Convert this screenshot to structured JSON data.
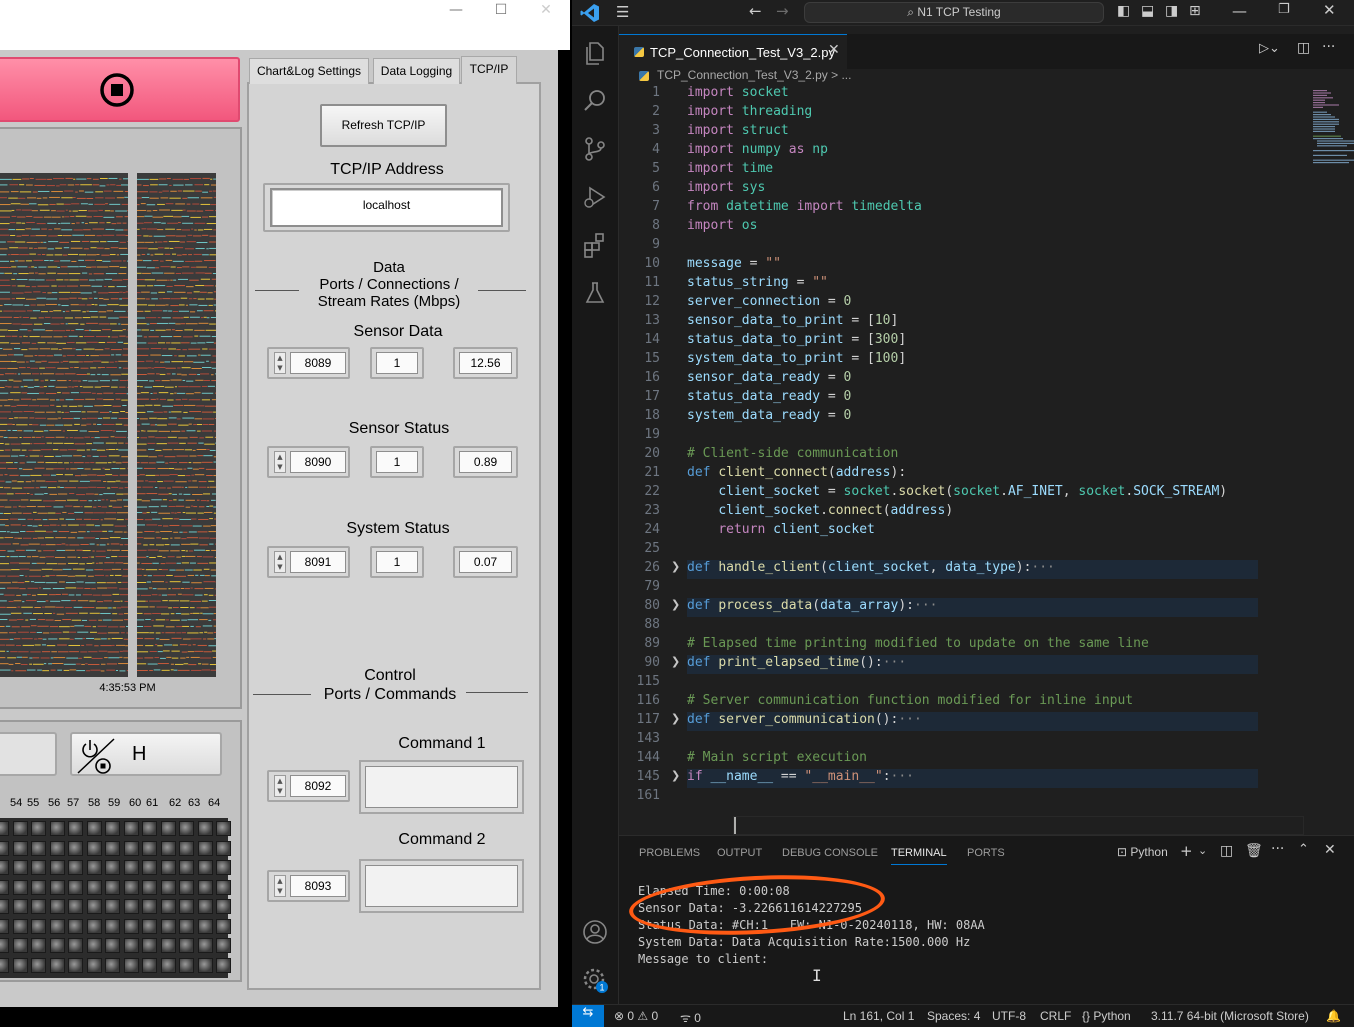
{
  "labview": {
    "window_controls": [
      "—",
      "☐",
      "✕"
    ],
    "tabs": [
      "Chart&Log Settings",
      "Data Logging",
      "TCP/IP"
    ],
    "refresh_label": "Refresh TCP/IP",
    "tcp_address_label": "TCP/IP Address",
    "tcp_address_value": "localhost",
    "data_section": [
      "Data",
      "Ports / Connections /",
      "Stream Rates (Mbps)"
    ],
    "sensor_data": {
      "label": "Sensor Data",
      "port": "8089",
      "connections": "1",
      "rate": "12.56"
    },
    "sensor_status": {
      "label": "Sensor Status",
      "port": "8090",
      "connections": "1",
      "rate": "0.89"
    },
    "system_status": {
      "label": "System Status",
      "port": "8091",
      "connections": "1",
      "rate": "0.07"
    },
    "control_section": [
      "Control",
      "Ports / Commands"
    ],
    "command1": {
      "label": "Command 1",
      "port": "8092"
    },
    "command2": {
      "label": "Command 2",
      "port": "8093"
    },
    "chart_time": "4:35:53 PM",
    "h_button_label": "H",
    "channel_numbers": [
      "54",
      "55",
      "56",
      "57",
      "58",
      "59",
      "60",
      "61",
      "62",
      "63",
      "64"
    ]
  },
  "vscode": {
    "search_label": "N1 TCP Testing",
    "file_tab": "TCP_Connection_Test_V3_2.py",
    "breadcrumb": "TCP_Connection_Test_V3_2.py > ...",
    "code_lines": [
      {
        "n": "1",
        "segs": [
          [
            "kw2",
            "import"
          ],
          [
            "op",
            " "
          ],
          [
            "nm",
            "socket"
          ]
        ]
      },
      {
        "n": "2",
        "segs": [
          [
            "kw2",
            "import"
          ],
          [
            "op",
            " "
          ],
          [
            "nm",
            "threading"
          ]
        ]
      },
      {
        "n": "3",
        "segs": [
          [
            "kw2",
            "import"
          ],
          [
            "op",
            " "
          ],
          [
            "nm",
            "struct"
          ]
        ]
      },
      {
        "n": "4",
        "segs": [
          [
            "kw2",
            "import"
          ],
          [
            "op",
            " "
          ],
          [
            "nm",
            "numpy"
          ],
          [
            "op",
            " "
          ],
          [
            "kw2",
            "as"
          ],
          [
            "op",
            " "
          ],
          [
            "nm",
            "np"
          ]
        ]
      },
      {
        "n": "5",
        "segs": [
          [
            "kw2",
            "import"
          ],
          [
            "op",
            " "
          ],
          [
            "nm",
            "time"
          ]
        ]
      },
      {
        "n": "6",
        "segs": [
          [
            "kw2",
            "import"
          ],
          [
            "op",
            " "
          ],
          [
            "nm",
            "sys"
          ]
        ]
      },
      {
        "n": "7",
        "segs": [
          [
            "kw2",
            "from"
          ],
          [
            "op",
            " "
          ],
          [
            "nm",
            "datetime"
          ],
          [
            "op",
            " "
          ],
          [
            "kw2",
            "import"
          ],
          [
            "op",
            " "
          ],
          [
            "nm",
            "timedelta"
          ]
        ]
      },
      {
        "n": "8",
        "segs": [
          [
            "kw2",
            "import"
          ],
          [
            "op",
            " "
          ],
          [
            "nm",
            "os"
          ]
        ]
      },
      {
        "n": "9",
        "segs": []
      },
      {
        "n": "10",
        "segs": [
          [
            "vr",
            "message"
          ],
          [
            "op",
            " = "
          ],
          [
            "str",
            "\"\""
          ]
        ]
      },
      {
        "n": "11",
        "segs": [
          [
            "vr",
            "status_string"
          ],
          [
            "op",
            " = "
          ],
          [
            "str",
            "\"\""
          ]
        ]
      },
      {
        "n": "12",
        "segs": [
          [
            "vr",
            "server_connection"
          ],
          [
            "op",
            " = "
          ],
          [
            "num",
            "0"
          ]
        ]
      },
      {
        "n": "13",
        "segs": [
          [
            "vr",
            "sensor_data_to_print"
          ],
          [
            "op",
            " = ["
          ],
          [
            "num",
            "10"
          ],
          [
            "op",
            "]"
          ]
        ]
      },
      {
        "n": "14",
        "segs": [
          [
            "vr",
            "status_data_to_print"
          ],
          [
            "op",
            " = ["
          ],
          [
            "num",
            "300"
          ],
          [
            "op",
            "]"
          ]
        ]
      },
      {
        "n": "15",
        "segs": [
          [
            "vr",
            "system_data_to_print"
          ],
          [
            "op",
            " = ["
          ],
          [
            "num",
            "100"
          ],
          [
            "op",
            "]"
          ]
        ]
      },
      {
        "n": "16",
        "segs": [
          [
            "vr",
            "sensor_data_ready"
          ],
          [
            "op",
            " = "
          ],
          [
            "num",
            "0"
          ]
        ]
      },
      {
        "n": "17",
        "segs": [
          [
            "vr",
            "status_data_ready"
          ],
          [
            "op",
            " = "
          ],
          [
            "num",
            "0"
          ]
        ]
      },
      {
        "n": "18",
        "segs": [
          [
            "vr",
            "system_data_ready"
          ],
          [
            "op",
            " = "
          ],
          [
            "num",
            "0"
          ]
        ]
      },
      {
        "n": "19",
        "segs": []
      },
      {
        "n": "20",
        "segs": [
          [
            "cm",
            "# Client-side communication"
          ]
        ]
      },
      {
        "n": "21",
        "segs": [
          [
            "kw",
            "def"
          ],
          [
            "op",
            " "
          ],
          [
            "fn",
            "client_connect"
          ],
          [
            "op",
            "("
          ],
          [
            "vr",
            "address"
          ],
          [
            "op",
            "):"
          ]
        ]
      },
      {
        "n": "22",
        "segs": [
          [
            "op",
            "    "
          ],
          [
            "vr",
            "client_socket"
          ],
          [
            "op",
            " = "
          ],
          [
            "nm",
            "socket"
          ],
          [
            "op",
            "."
          ],
          [
            "fn",
            "socket"
          ],
          [
            "op",
            "("
          ],
          [
            "nm",
            "socket"
          ],
          [
            "op",
            "."
          ],
          [
            "vr",
            "AF_INET"
          ],
          [
            "op",
            ", "
          ],
          [
            "nm",
            "socket"
          ],
          [
            "op",
            "."
          ],
          [
            "vr",
            "SOCK_STREAM"
          ],
          [
            "op",
            ")"
          ]
        ]
      },
      {
        "n": "23",
        "segs": [
          [
            "op",
            "    "
          ],
          [
            "vr",
            "client_socket"
          ],
          [
            "op",
            "."
          ],
          [
            "fn",
            "connect"
          ],
          [
            "op",
            "("
          ],
          [
            "vr",
            "address"
          ],
          [
            "op",
            ")"
          ]
        ]
      },
      {
        "n": "24",
        "segs": [
          [
            "op",
            "    "
          ],
          [
            "kw2",
            "return"
          ],
          [
            "op",
            " "
          ],
          [
            "vr",
            "client_socket"
          ]
        ]
      },
      {
        "n": "25",
        "segs": []
      },
      {
        "n": "26",
        "fold": true,
        "segs": [
          [
            "kw",
            "def"
          ],
          [
            "op",
            " "
          ],
          [
            "fn",
            "handle_client"
          ],
          [
            "op",
            "("
          ],
          [
            "vr",
            "client_socket"
          ],
          [
            "op",
            ", "
          ],
          [
            "vr",
            "data_type"
          ],
          [
            "op",
            "):"
          ],
          [
            "ell",
            "···"
          ]
        ]
      },
      {
        "n": "79",
        "segs": []
      },
      {
        "n": "80",
        "fold": true,
        "segs": [
          [
            "kw",
            "def"
          ],
          [
            "op",
            " "
          ],
          [
            "fn",
            "process_data"
          ],
          [
            "op",
            "("
          ],
          [
            "vr",
            "data_array"
          ],
          [
            "op",
            "):"
          ],
          [
            "ell",
            "···"
          ]
        ]
      },
      {
        "n": "88",
        "segs": []
      },
      {
        "n": "89",
        "segs": [
          [
            "cm",
            "# Elapsed time printing modified to update on the same line"
          ]
        ]
      },
      {
        "n": "90",
        "fold": true,
        "segs": [
          [
            "kw",
            "def"
          ],
          [
            "op",
            " "
          ],
          [
            "fn",
            "print_elapsed_time"
          ],
          [
            "op",
            "():"
          ],
          [
            "ell",
            "···"
          ]
        ]
      },
      {
        "n": "115",
        "segs": []
      },
      {
        "n": "116",
        "segs": [
          [
            "cm",
            "# Server communication function modified for inline input"
          ]
        ]
      },
      {
        "n": "117",
        "fold": true,
        "segs": [
          [
            "kw",
            "def"
          ],
          [
            "op",
            " "
          ],
          [
            "fn",
            "server_communication"
          ],
          [
            "op",
            "():"
          ],
          [
            "ell",
            "···"
          ]
        ]
      },
      {
        "n": "143",
        "segs": []
      },
      {
        "n": "144",
        "segs": [
          [
            "cm",
            "# Main script execution"
          ]
        ]
      },
      {
        "n": "145",
        "fold": true,
        "segs": [
          [
            "kw2",
            "if"
          ],
          [
            "op",
            " "
          ],
          [
            "vr",
            "__name__"
          ],
          [
            "op",
            " == "
          ],
          [
            "str",
            "\"__main__\""
          ],
          [
            "op",
            ":"
          ],
          [
            "ell",
            "···"
          ]
        ]
      },
      {
        "n": "161",
        "segs": []
      }
    ],
    "panel_tabs": [
      "PROBLEMS",
      "OUTPUT",
      "DEBUG CONSOLE",
      "TERMINAL",
      "PORTS"
    ],
    "terminal_profile": "Python",
    "terminal_lines": [
      "Elapsed Time: 0:00:08",
      "Sensor Data: -3.226611614227295",
      "Status Data: #CH:1   FW: N1-0-20240118, HW: 08AA",
      "System Data: Data Acquisition Rate:1500.000 Hz",
      "Message to client:"
    ],
    "status": {
      "errors": "0",
      "warnings": "0",
      "ports": "0",
      "position": "Ln 161, Col 1",
      "spaces": "Spaces: 4",
      "encoding": "UTF-8",
      "eol": "CRLF",
      "language": "Python",
      "interpreter": "3.11.7 64-bit (Microsoft Store)"
    },
    "notification_badge": "1"
  }
}
